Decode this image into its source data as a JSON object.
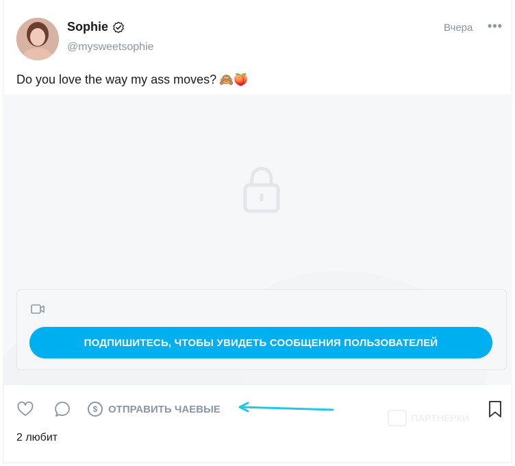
{
  "post": {
    "author_name": "Sophie",
    "author_handle": "@mysweetsophie",
    "timestamp": "Вчера",
    "more_label": "•••",
    "caption": "Do you love the way my ass moves?",
    "caption_emoji": "🙈🍑"
  },
  "media": {
    "subscribe_button": "ПОДПИШИТЕСЬ, ЧТОБЫ УВИДЕТЬ СООБЩЕНИЯ ПОЛЬЗОВАТЕЛЕЙ"
  },
  "actions": {
    "tip_label": "ОТПРАВИТЬ ЧАЕВЫЕ",
    "coin_symbol": "$",
    "likes_text": "2 любит"
  },
  "watermark": {
    "text": "ПАРТНЕРКИ"
  },
  "icons": {
    "verified": "verified-check-icon",
    "lock": "lock-icon",
    "video": "video-camera-icon",
    "like": "heart-icon",
    "comment": "comment-bubble-icon",
    "tip": "dollar-coin-icon",
    "bookmark": "bookmark-icon",
    "arrow": "arrow-left-annotation-icon"
  },
  "colors": {
    "accent": "#00aff0",
    "muted": "#8a96a3",
    "annotation_arrow": "#22c8e0"
  }
}
